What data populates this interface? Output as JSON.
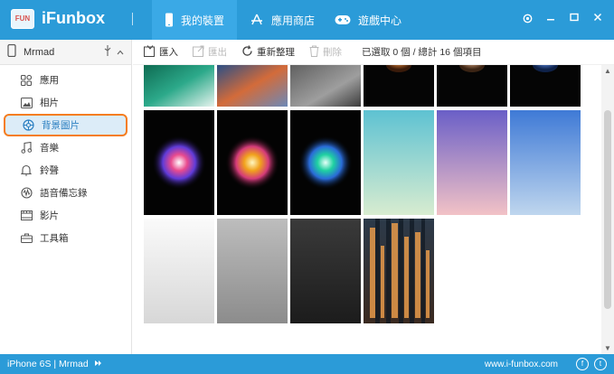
{
  "app": {
    "logo_badge": "FUN",
    "title": "iFunbox"
  },
  "tabs": [
    {
      "label": "我的裝置",
      "icon": "phone-icon",
      "active": true
    },
    {
      "label": "應用商店",
      "icon": "app-store-icon",
      "active": false
    },
    {
      "label": "遊戲中心",
      "icon": "gamepad-icon",
      "active": false
    }
  ],
  "device": {
    "name": "Mrmad"
  },
  "sidebar": {
    "items": [
      {
        "label": "應用",
        "icon": "apps-grid-icon"
      },
      {
        "label": "相片",
        "icon": "photo-icon"
      },
      {
        "label": "背景圖片",
        "icon": "wallpaper-icon",
        "active": true
      },
      {
        "label": "音樂",
        "icon": "music-note-icon"
      },
      {
        "label": "鈴聲",
        "icon": "bell-icon"
      },
      {
        "label": "語音備忘錄",
        "icon": "voice-memo-icon"
      },
      {
        "label": "影片",
        "icon": "film-icon"
      },
      {
        "label": "工具箱",
        "icon": "toolbox-icon"
      }
    ]
  },
  "toolbar": {
    "import_label": "匯入",
    "export_label": "匯出",
    "refresh_label": "重新整理",
    "delete_label": "刪除",
    "status_text": "已選取 0 個 / 總計 16 個項目"
  },
  "statusbar": {
    "device_text": "iPhone 6S | Mrmad",
    "website": "www.i-funbox.com"
  },
  "colors": {
    "primary": "#2b9bd8",
    "active_tab": "#3aa9e6",
    "highlight_border": "#f57d1f",
    "active_item_bg": "#dcecf8"
  }
}
